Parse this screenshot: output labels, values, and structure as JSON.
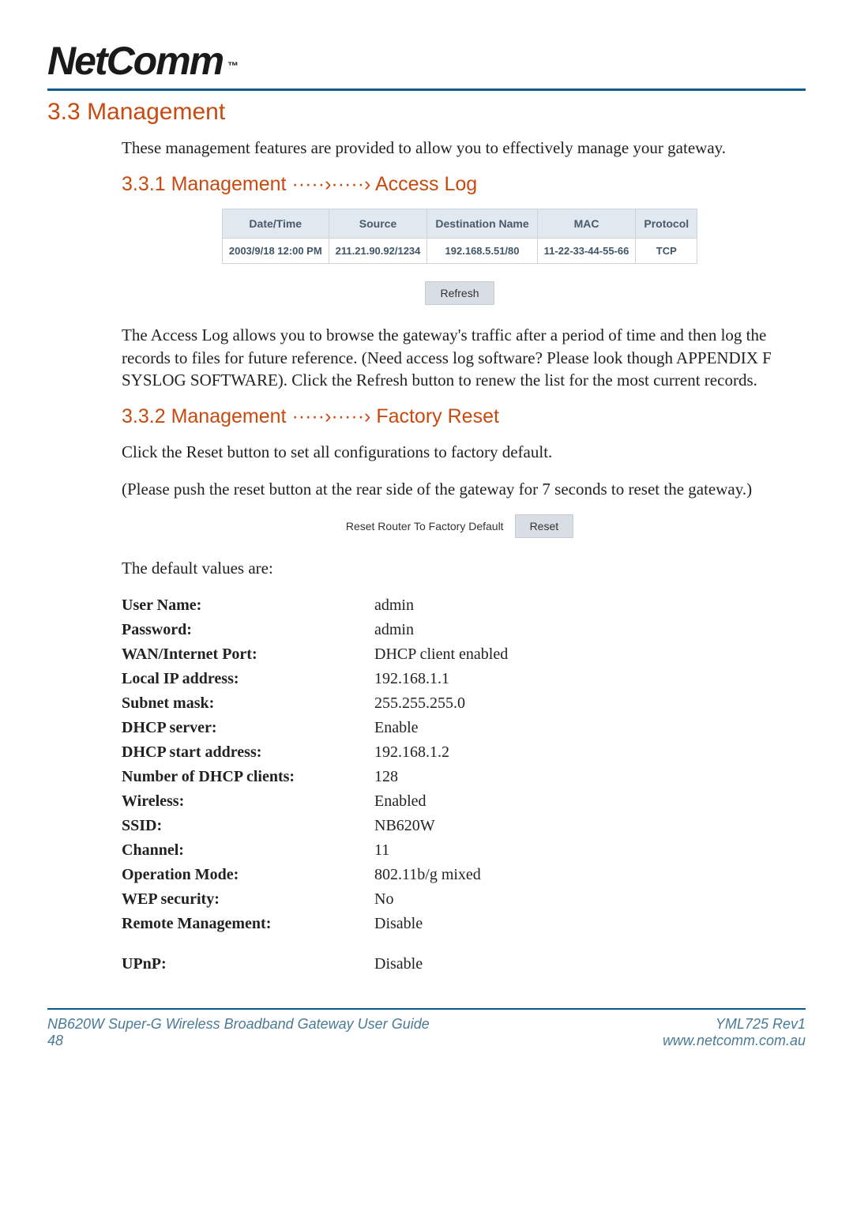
{
  "brand": {
    "name": "NetComm",
    "tm": "™"
  },
  "section": {
    "num": "3.3",
    "title": "Management"
  },
  "intro": "These management features are provided to allow you to effectively manage your gateway.",
  "sub_access": {
    "num": "3.3.1",
    "label_a": "Management",
    "label_b": "Access Log"
  },
  "access_log_table": {
    "headers": {
      "date": "Date/Time",
      "source": "Source",
      "dest": "Destination Name",
      "mac": "MAC",
      "proto": "Protocol"
    },
    "row": {
      "date": "2003/9/18 12:00 PM",
      "source": "211.21.90.92/1234",
      "dest": "192.168.5.51/80",
      "mac": "11-22-33-44-55-66",
      "proto": "TCP"
    }
  },
  "refresh_btn": "Refresh",
  "access_para": "The Access Log allows you to browse the gateway's traffic after a period of time and then log the records to files for future reference. (Need access log software? Please look though APPENDIX F SYSLOG SOFTWARE). Click the Refresh button to renew the list for the most current records.",
  "sub_factory": {
    "num": "3.3.2",
    "label_a": "Management",
    "label_b": "Factory Reset"
  },
  "factory_p1": "Click the Reset button to set all configurations to factory default.",
  "factory_p2": "(Please push the reset button at the rear side of the gateway for 7 seconds to reset the gateway.)",
  "reset_label": "Reset Router To Factory Default",
  "reset_btn": "Reset",
  "defaults_intro": "The default values are:",
  "defaults": [
    {
      "k": "User Name:",
      "v": "admin"
    },
    {
      "k": "Password:",
      "v": "admin"
    },
    {
      "k": "WAN/Internet Port:",
      "v": "DHCP client enabled"
    },
    {
      "k": "Local IP address:",
      "v": "192.168.1.1"
    },
    {
      "k": "Subnet mask:",
      "v": "255.255.255.0"
    },
    {
      "k": "DHCP server:",
      "v": "Enable"
    },
    {
      "k": "DHCP start address:",
      "v": "192.168.1.2"
    },
    {
      "k": "Number of DHCP clients:",
      "v": "128"
    },
    {
      "k": "Wireless:",
      "v": "Enabled"
    },
    {
      "k": "SSID:",
      "v": "NB620W"
    },
    {
      "k": "Channel:",
      "v": "11"
    },
    {
      "k": "Operation Mode:",
      "v": "802.11b/g mixed"
    },
    {
      "k": "WEP security:",
      "v": "No"
    },
    {
      "k": "Remote Management:",
      "v": "Disable"
    }
  ],
  "defaults_last": {
    "k": "UPnP:",
    "v": "Disable"
  },
  "footer": {
    "guide": "NB620W Super-G Wireless Broadband  Gateway User Guide",
    "page": "48",
    "rev": "YML725 Rev1",
    "url": "www.netcomm.com.au"
  }
}
